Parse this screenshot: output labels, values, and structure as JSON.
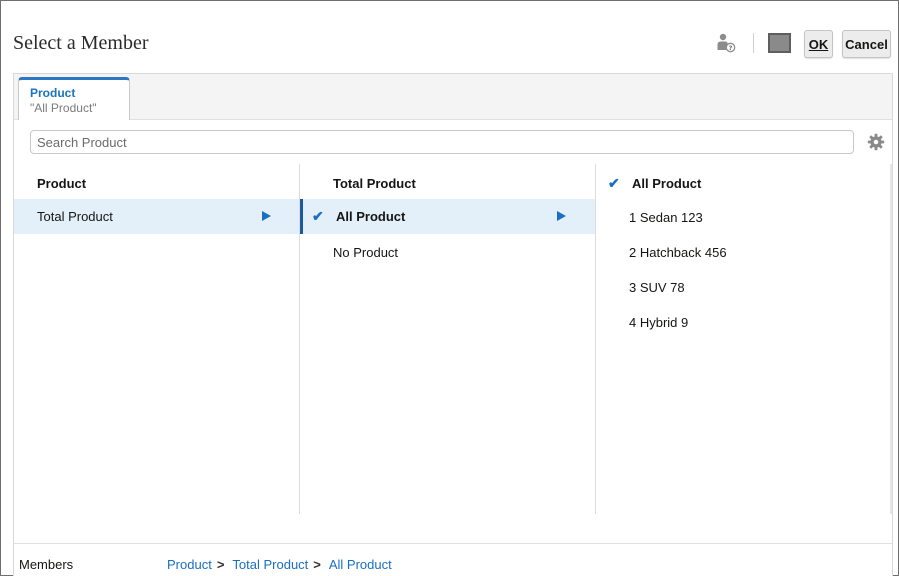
{
  "dialog": {
    "title": "Select a Member",
    "ok_label": "OK",
    "cancel_label": "Cancel",
    "swatch_color": "#8a8a8a"
  },
  "tab": {
    "title": "Product",
    "subtitle": "\"All Product\""
  },
  "search": {
    "placeholder": "Search Product",
    "value": ""
  },
  "columns": [
    {
      "header": "Product",
      "items": [
        {
          "label": "Total Product",
          "selected": true,
          "has_children": true
        }
      ]
    },
    {
      "header": "Total Product",
      "items": [
        {
          "label": "All Product",
          "selected": true,
          "checked": true,
          "has_children": true
        },
        {
          "label": "No Product",
          "selected": false
        }
      ]
    },
    {
      "header": "All Product",
      "header_checked": true,
      "items": [
        {
          "label": "1 Sedan 123"
        },
        {
          "label": "2 Hatchback 456"
        },
        {
          "label": "3 SUV 78"
        },
        {
          "label": "4 Hybrid 9"
        }
      ]
    }
  ],
  "footer": {
    "label": "Members",
    "breadcrumbs": [
      "Product",
      "Total Product",
      "All Product"
    ],
    "separator": ">"
  },
  "colors": {
    "accent": "#1a6fc2",
    "selected_row": "#e4f0f9"
  }
}
